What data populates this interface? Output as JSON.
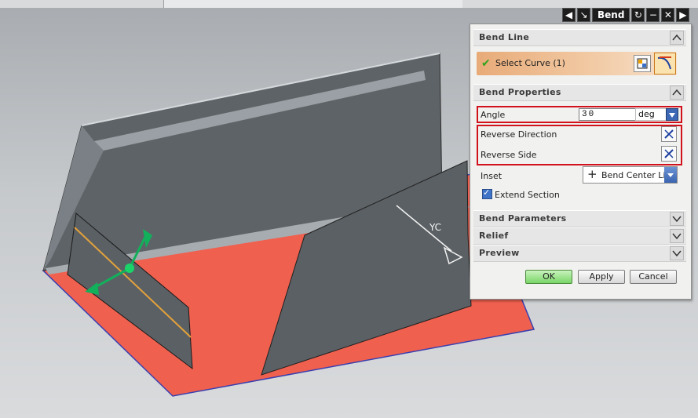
{
  "top_bar": {
    "partial_text": "~"
  },
  "model": {
    "axis_label": "YC"
  },
  "dialog": {
    "title": "Bend",
    "title_buttons": [
      "◀",
      "↘",
      "↻",
      "−",
      "✕",
      "▶"
    ],
    "groups": {
      "bend_line": {
        "label": "Bend Line",
        "select_curve": "Select Curve (1)"
      },
      "bend_properties": {
        "label": "Bend Properties",
        "angle_label": "Angle",
        "angle_value": "30",
        "angle_unit": "deg",
        "reverse_direction": "Reverse Direction",
        "reverse_side": "Reverse Side",
        "inset_label": "Inset",
        "inset_value": "Bend Center Line",
        "extend_section": "Extend Section"
      },
      "bend_parameters": {
        "label": "Bend Parameters"
      },
      "relief": {
        "label": "Relief"
      },
      "preview": {
        "label": "Preview"
      }
    },
    "buttons": {
      "ok": "OK",
      "apply": "Apply",
      "cancel": "Cancel"
    }
  },
  "colors": {
    "highlight": "#d1111c",
    "face_selected": "#f0604f",
    "face_default": "#5b6064",
    "ok_green": "#79d567"
  }
}
